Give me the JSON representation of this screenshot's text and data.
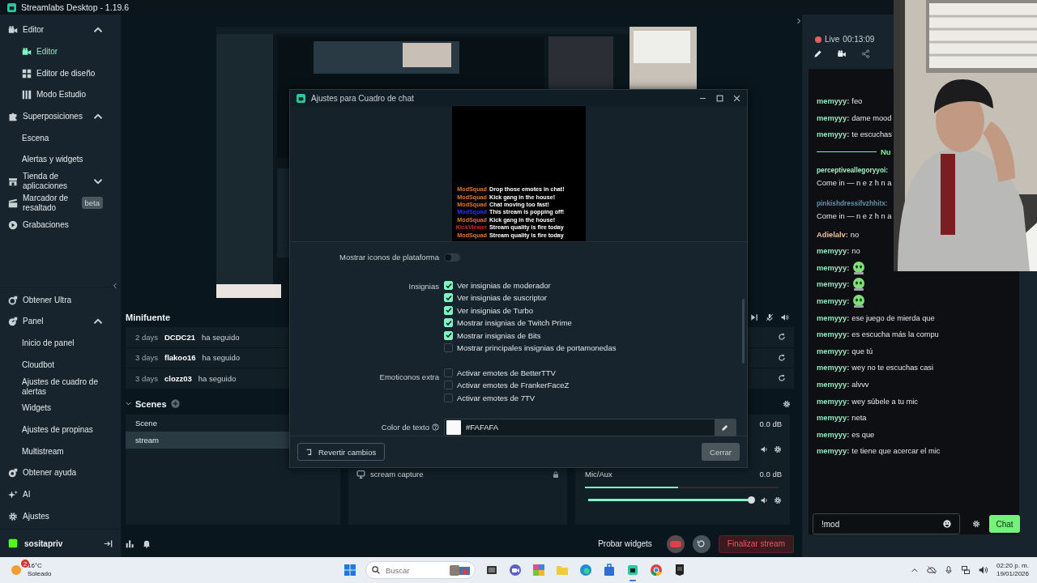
{
  "app": {
    "title": "Streamlabs Desktop - 1.19.6"
  },
  "sidebar": {
    "top": [
      {
        "label": "Editor",
        "selected": false,
        "expanded": true,
        "children": [
          {
            "label": "Editor",
            "selected": true
          },
          {
            "label": "Editor de diseño",
            "selected": false
          },
          {
            "label": "Modo Estudio",
            "selected": false
          }
        ]
      },
      {
        "label": "Superposiciones",
        "selected": false,
        "expanded": true,
        "children": [
          {
            "label": "Escena",
            "selected": false
          },
          {
            "label": "Alertas y widgets",
            "selected": false
          }
        ]
      },
      {
        "label": "Tienda de aplicaciones",
        "selected": false,
        "expanded": false
      },
      {
        "label": "Marcador de resaltado",
        "selected": false,
        "badge": "beta"
      },
      {
        "label": "Grabaciones",
        "selected": false
      }
    ],
    "bottom": [
      {
        "label": "Obtener Ultra",
        "selected": false
      },
      {
        "label": "Panel",
        "selected": false,
        "expanded": true,
        "children": [
          {
            "label": "Inicio de panel",
            "selected": false
          },
          {
            "label": "Cloudbot",
            "selected": false
          },
          {
            "label": "Ajustes de cuadro de alertas",
            "selected": false
          },
          {
            "label": "Widgets",
            "selected": false
          },
          {
            "label": "Ajustes de propinas",
            "selected": false
          },
          {
            "label": "Multistream",
            "selected": false
          }
        ]
      },
      {
        "label": "Obtener ayuda",
        "selected": false
      },
      {
        "label": "AI",
        "selected": false
      },
      {
        "label": "Ajustes",
        "selected": false
      }
    ],
    "user": {
      "name": "sositapriv"
    }
  },
  "minifeed": {
    "title": "Minifuente",
    "events": [
      {
        "time": "2 days",
        "user": "DCDC21",
        "action": "ha seguido"
      },
      {
        "time": "3 days",
        "user": "flakoo16",
        "action": "ha seguido"
      },
      {
        "time": "3 days",
        "user": "clozz03",
        "action": "ha seguido"
      }
    ]
  },
  "scenes": {
    "title": "Scenes",
    "expanded": true,
    "items": [
      {
        "label": "Scene",
        "selected": false
      },
      {
        "label": "stream",
        "selected": true
      }
    ]
  },
  "sources": {
    "items": [
      {
        "label": "scream capture",
        "locked": true
      }
    ]
  },
  "mixer": {
    "channels": [
      {
        "reading": "0.0 dB"
      },
      {
        "name": "Mic/Aux",
        "reading": "0.0 dB",
        "meter": {
          "level": 0.48
        },
        "volume": {
          "level": 1
        }
      }
    ]
  },
  "bottom_bar": {
    "test_widgets": "Probar widgets",
    "end_stream": "Finalizar stream"
  },
  "live": {
    "label": "Live",
    "time": "00:13:09"
  },
  "chat": {
    "messages": [
      {
        "kind": "text",
        "user": "memyyy:",
        "color": "#98e6c0",
        "text": "feo"
      },
      {
        "kind": "text",
        "user": "memyyy:",
        "color": "#98e6c0",
        "text": "dame mood"
      },
      {
        "kind": "text",
        "user": "memyyy:",
        "color": "#98e6c0",
        "text": "te escuchas"
      },
      {
        "kind": "divider",
        "text": "Nu"
      },
      {
        "kind": "wrapped",
        "user": "perceptiveallegoryyoi:",
        "color": "#a6efc6",
        "text": "Come in — n e z h n a"
      },
      {
        "kind": "wrapped",
        "user": "pinkishdressifvzhhitx:",
        "color": "#5f92ab",
        "text": "Come in — n e z h n a"
      },
      {
        "kind": "text",
        "user": "Adielalv:",
        "color": "#f2c29a",
        "text": "no"
      },
      {
        "kind": "text",
        "user": "memyyy:",
        "color": "#98e6c0",
        "text": "no"
      },
      {
        "kind": "emote",
        "user": "memyyy:",
        "color": "#98e6c0"
      },
      {
        "kind": "emote",
        "user": "memyyy:",
        "color": "#98e6c0"
      },
      {
        "kind": "emote",
        "user": "memyyy:",
        "color": "#98e6c0"
      },
      {
        "kind": "text",
        "user": "memyyy:",
        "color": "#98e6c0",
        "text": "ese juego de mierda que"
      },
      {
        "kind": "text",
        "user": "memyyy:",
        "color": "#98e6c0",
        "text": "es escucha más la compu"
      },
      {
        "kind": "text",
        "user": "memyyy:",
        "color": "#98e6c0",
        "text": "que tú"
      },
      {
        "kind": "text",
        "user": "memyyy:",
        "color": "#98e6c0",
        "text": "wey no te escuchas casi"
      },
      {
        "kind": "text",
        "user": "memyyy:",
        "color": "#98e6c0",
        "text": "alvvv"
      },
      {
        "kind": "text",
        "user": "memyyy:",
        "color": "#98e6c0",
        "text": "wey súbele a tu mic"
      },
      {
        "kind": "text",
        "user": "memyyy:",
        "color": "#98e6c0",
        "text": "neta"
      },
      {
        "kind": "text",
        "user": "memyyy:",
        "color": "#98e6c0",
        "text": "es que"
      },
      {
        "kind": "text",
        "user": "memyyy:",
        "color": "#98e6c0",
        "text": "te tiene que acercar el mic"
      }
    ],
    "input": {
      "value": "!mod"
    },
    "send": "Chat"
  },
  "dialog": {
    "title": "Ajustes para Cuadro de chat",
    "preview": [
      {
        "user": "ModSquad",
        "color": "#e0782a",
        "text": "Drop those emotes in chat!"
      },
      {
        "user": "ModSquad",
        "color": "#e0782a",
        "text": "Kick gang in the house!"
      },
      {
        "user": "ModSquad",
        "color": "#e0782a",
        "text": "Chat moving too fast!"
      },
      {
        "user": "ModSquad",
        "color": "#2b35ff",
        "text": "This stream is popping off!"
      },
      {
        "user": "ModSquad",
        "color": "#e0782a",
        "text": "Kick gang in the house!"
      },
      {
        "user": "KickViewer",
        "color": "#d42a2a",
        "text": "Stream quality is fire today"
      },
      {
        "user": "ModSquad",
        "color": "#e0782a",
        "text": "Stream quality is fire today"
      }
    ],
    "settings": [
      {
        "kind": "toggle",
        "label": "Mostrar iconos de plataforma",
        "on": false
      },
      {
        "kind": "checks",
        "label": "Insignias",
        "options": [
          {
            "label": "Ver insignias de moderador",
            "checked": true
          },
          {
            "label": "Ver insignias de suscriptor",
            "checked": true
          },
          {
            "label": "Ver insignias de Turbo",
            "checked": true
          },
          {
            "label": "Mostrar insignias de Twitch Prime",
            "checked": true
          },
          {
            "label": "Mostrar insignias de Bits",
            "checked": true
          },
          {
            "label": "Mostrar principales insignias de portamonedas",
            "checked": false
          }
        ]
      },
      {
        "kind": "checks",
        "label": "Emoticonos extra",
        "options": [
          {
            "label": "Activar emotes de BetterTTV",
            "checked": false
          },
          {
            "label": "Activar emotes de FrankerFaceZ",
            "checked": false
          },
          {
            "label": "Activar emotes de 7TV",
            "checked": false
          }
        ]
      },
      {
        "kind": "color",
        "label": "Color de texto",
        "value": "#FAFAFA"
      }
    ],
    "revert": "Revertir cambios",
    "close": "Cerrar"
  },
  "taskbar": {
    "weather": {
      "badge": "2",
      "temp": "16°C",
      "condition": "Soleado"
    },
    "search": {
      "placeholder": "Buscar"
    },
    "apps": [
      {
        "selected": false
      },
      {
        "selected": false
      },
      {
        "selected": false
      },
      {
        "selected": false
      },
      {
        "selected": false
      },
      {
        "selected": false
      },
      {
        "selected": true
      },
      {
        "selected": false
      },
      {
        "selected": false
      }
    ],
    "clock": {
      "time": "02:20 p. m.",
      "date": "19/01/2026"
    }
  }
}
